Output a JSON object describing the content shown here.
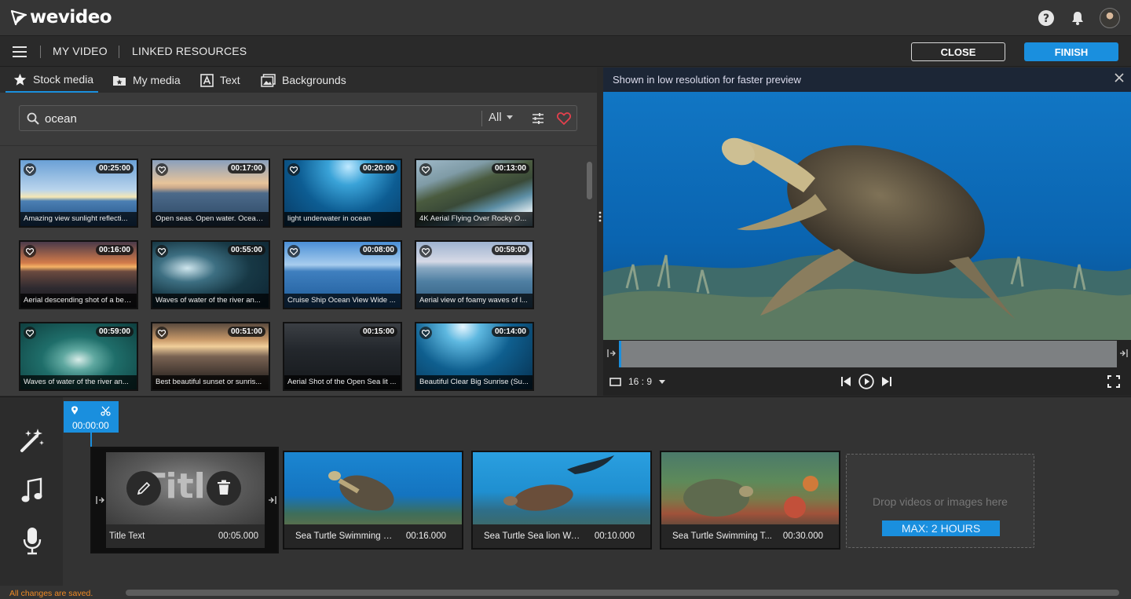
{
  "app": {
    "logo": "wevideo"
  },
  "menu": {
    "my_video": "MY VIDEO",
    "linked_resources": "LINKED RESOURCES",
    "close": "CLOSE",
    "finish": "FINISH"
  },
  "tabs": [
    {
      "label": "Stock media",
      "icon": "star-icon",
      "active": true
    },
    {
      "label": "My media",
      "icon": "media-folder-icon",
      "active": false
    },
    {
      "label": "Text",
      "icon": "text-icon",
      "active": false
    },
    {
      "label": "Backgrounds",
      "icon": "image-icon",
      "active": false
    }
  ],
  "search": {
    "value": "ocean",
    "filter": "All"
  },
  "media": [
    {
      "duration": "00:25:00",
      "caption": "Amazing view sunlight reflecti..."
    },
    {
      "duration": "00:17:00",
      "caption": "Open seas. Open water. Ocean ..."
    },
    {
      "duration": "00:20:00",
      "caption": "light underwater in ocean"
    },
    {
      "duration": "00:13:00",
      "caption": "4K Aerial Flying Over Rocky O..."
    },
    {
      "duration": "00:16:00",
      "caption": "Aerial descending shot of a bea..."
    },
    {
      "duration": "00:55:00",
      "caption": "Waves of water of the river an..."
    },
    {
      "duration": "00:08:00",
      "caption": "Cruise Ship Ocean View Wide ..."
    },
    {
      "duration": "00:59:00",
      "caption": "Aerial view of foamy waves of l..."
    },
    {
      "duration": "00:59:00",
      "caption": "Waves of water of the river an..."
    },
    {
      "duration": "00:51:00",
      "caption": "Best beautiful sunset or sunris..."
    },
    {
      "duration": "00:15:00",
      "caption": "Aerial Shot of the Open Sea lit ..."
    },
    {
      "duration": "00:14:00",
      "caption": "Beautiful Clear Big Sunrise (Su..."
    }
  ],
  "preview": {
    "notice": "Shown in low resolution for faster preview",
    "aspect": "16 : 9"
  },
  "timeline": {
    "playhead_time": "00:00:00",
    "title_overlay": "Title",
    "clips": [
      {
        "name": "Title Text",
        "duration": "00:05.000"
      },
      {
        "name": "Sea Turtle Swimming U...",
        "duration": "00:16.000"
      },
      {
        "name": "Sea Turtle Sea lion Wat...",
        "duration": "00:10.000"
      },
      {
        "name": "Sea Turtle Swimming T...",
        "duration": "00:30.000"
      }
    ],
    "drop_text": "Drop videos or images here",
    "max_label": "MAX: 2 HOURS"
  },
  "status": {
    "saved": "All changes are saved."
  },
  "colors": {
    "accent": "#1a8fde",
    "saved_text": "#f08a24",
    "favorite": "#e2404d"
  }
}
